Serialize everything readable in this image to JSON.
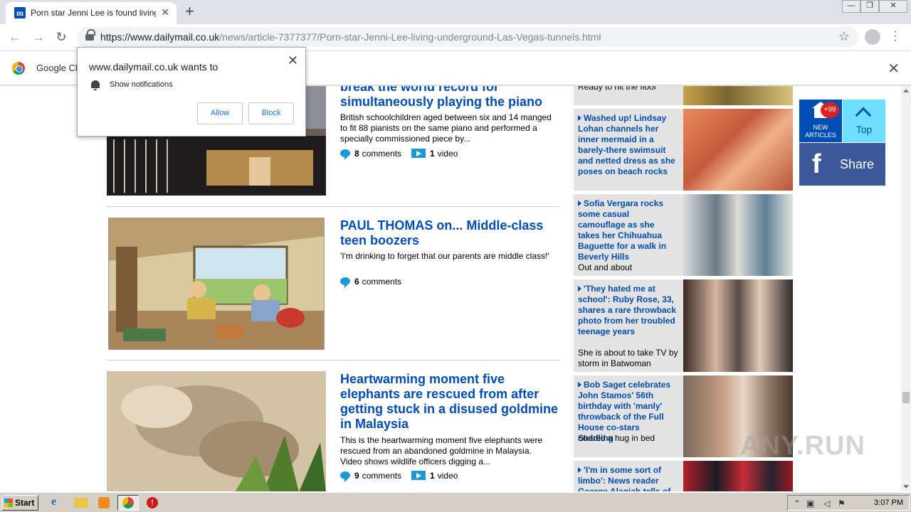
{
  "browser": {
    "tab_title": "Porn star Jenni Lee is found living in",
    "favicon_letter": "m",
    "new_tab": "+",
    "url_host": "https://www.dailymail.co.uk",
    "url_path": "/news/article-7377377/Porn-star-Jenni-Lee-living-underground-Las-Vegas-tunnels.html",
    "infobar_text": "Google Ch"
  },
  "notification": {
    "title": "www.dailymail.co.uk wants to",
    "permission": "Show notifications",
    "allow": "Allow",
    "block": "Block"
  },
  "stories": [
    {
      "headline": "break the world record for simultaneously playing the piano",
      "desc": "British schoolchildren aged between six and 14 manged to fit 88 pianists on the same piano and performed a specially commissioned piece by...",
      "comments_count": "8",
      "comments_label": "comments",
      "video_count": "1",
      "video_label": "video"
    },
    {
      "headline": "PAUL THOMAS on... Middle-class teen boozers",
      "desc": "'I'm drinking to forget that our parents are middle class!'",
      "comments_count": "6",
      "comments_label": "comments"
    },
    {
      "headline": "Heartwarming moment five elephants are rescued from after getting stuck in a disused goldmine in Malaysia",
      "desc": "This is the heartwarming moment five elephants were rescued from an abandoned goldmine in Malaysia. Video shows wildlife officers digging a...",
      "comments_count": "9",
      "comments_label": "comments",
      "video_count": "1",
      "video_label": "video"
    }
  ],
  "sidebar": [
    {
      "title": "",
      "sub": "Ready to hit the floor"
    },
    {
      "title": "Washed up! Lindsay Lohan channels her inner mermaid in a barely-there swimsuit and netted dress as she poses on beach rocks",
      "sub": ""
    },
    {
      "title": "Sofia Vergara rocks some casual camouflage as she takes her Chihuahua Baguette for a walk in Beverly Hills",
      "sub": "Out and about"
    },
    {
      "title": "'They hated me at school': Ruby Rose, 33, shares a rare throwback photo from her troubled teenage years",
      "sub": "She is about to take TV by storm in Batwoman"
    },
    {
      "title": "Bob Saget celebrates John Stamos' 56th birthday with 'manly' throwback of the Full House co-stars cuddling",
      "sub": "Shared a hug in bed"
    },
    {
      "title": "'I'm in some sort of limbo': News reader George Alagiah tells of",
      "sub": ""
    }
  ],
  "floating": {
    "new_badge": "+99",
    "new_label": "NEW ARTICLES",
    "top_label": "Top",
    "share_label": "Share",
    "fb_glyph": "f"
  },
  "taskbar": {
    "start": "Start",
    "clock": "3:07 PM"
  },
  "watermark": "ANY.RUN",
  "colors": {
    "link_blue": "#004db3",
    "bubble_blue": "#1c9ad6",
    "facebook": "#3b5998",
    "top_cyan": "#6ee0ff",
    "badge_red": "#e01e1e"
  }
}
